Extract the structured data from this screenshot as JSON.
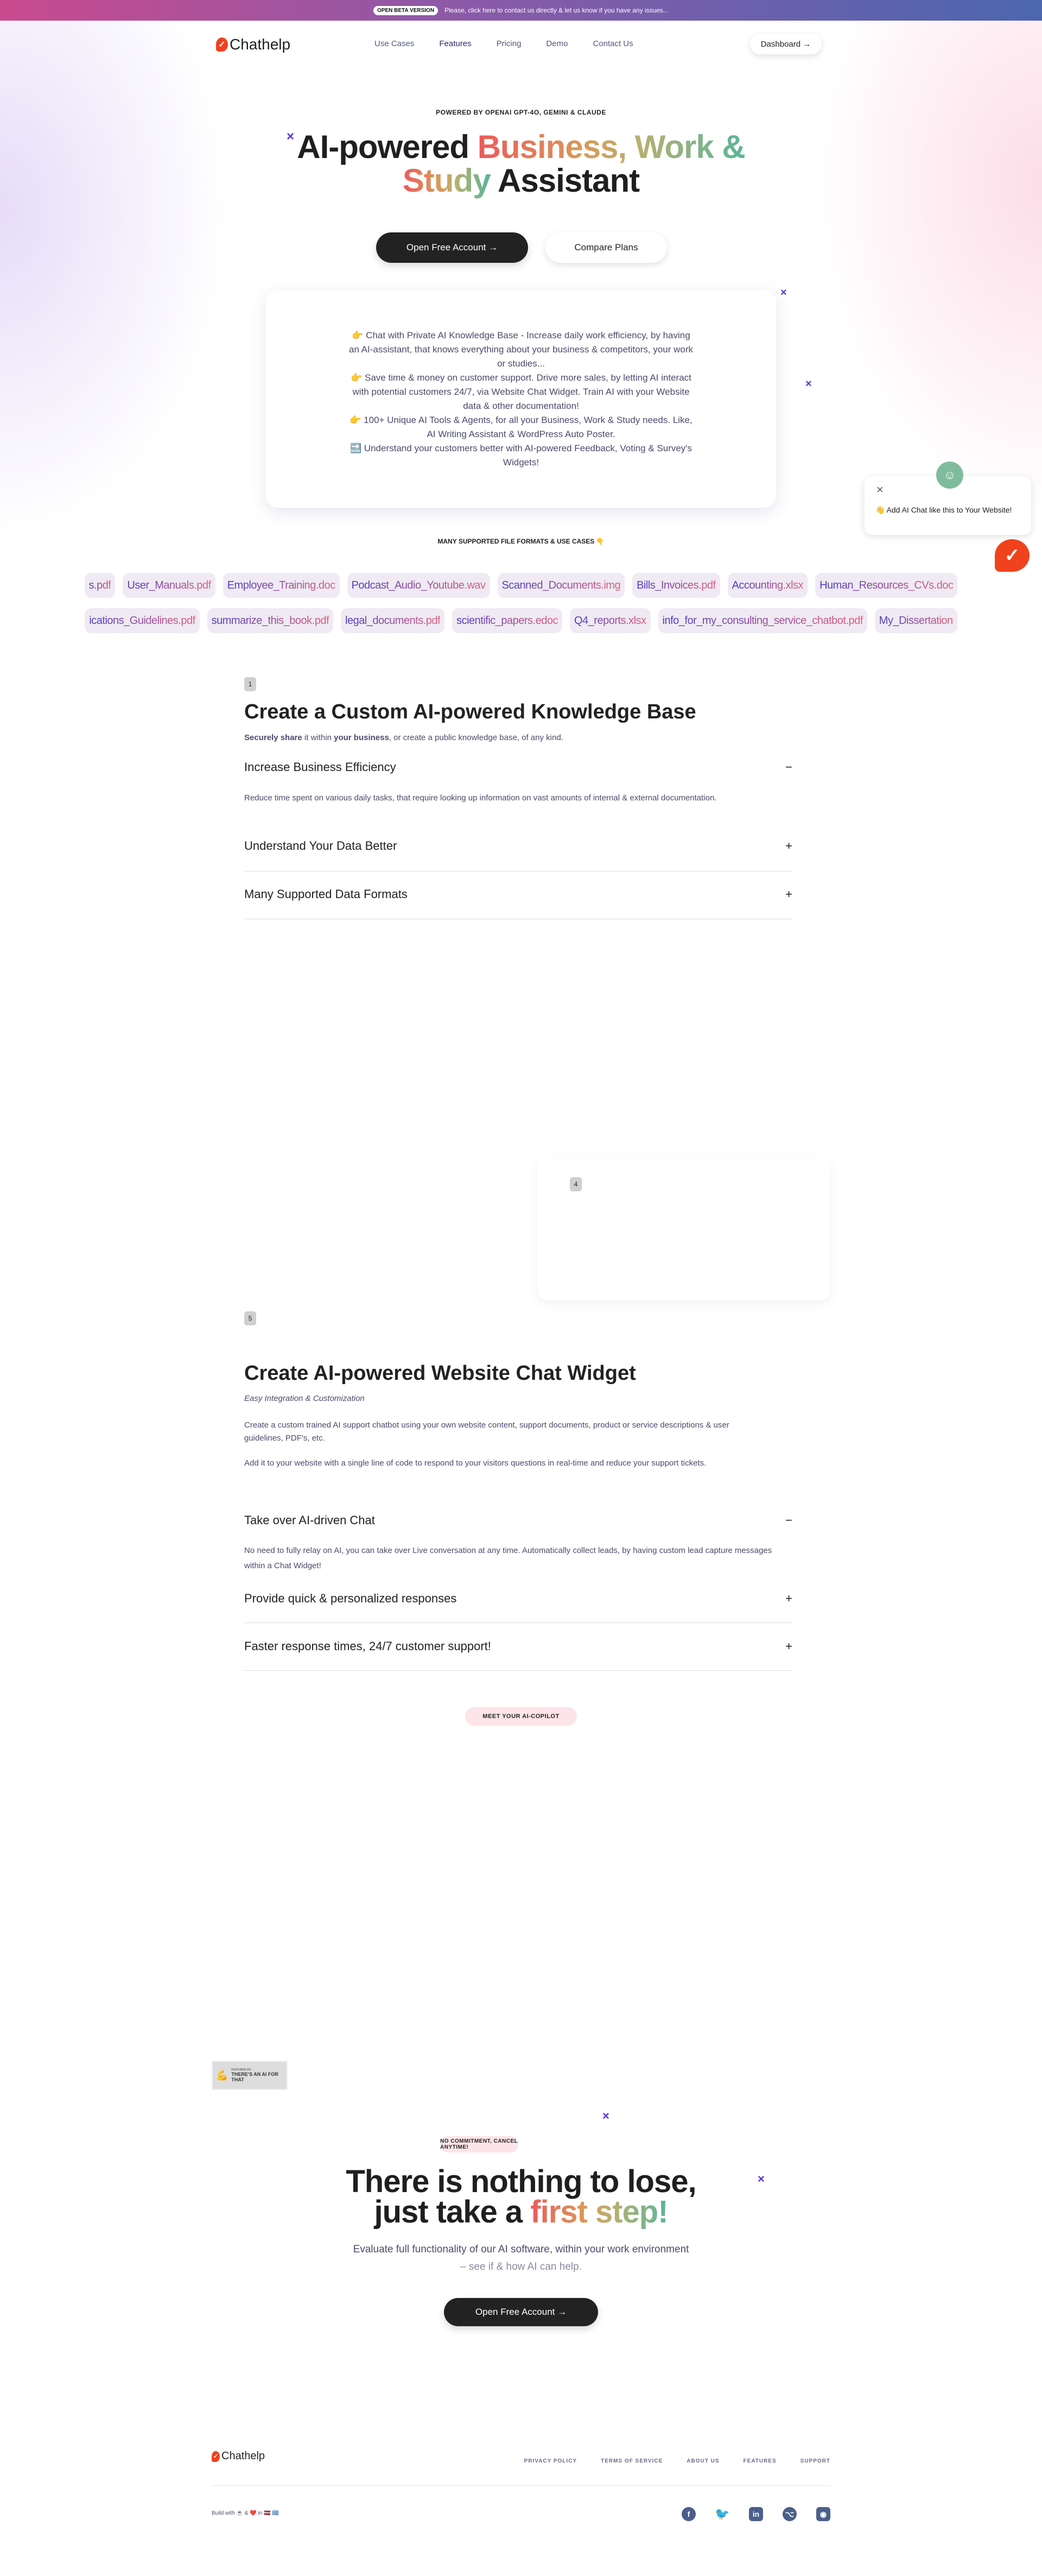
{
  "banner": {
    "badge": "OPEN BETA VERSION",
    "message": "Please, click here to contact us directly & let us know if you have any issues..."
  },
  "nav": {
    "logo": "Chathelp",
    "links": [
      "Use Cases",
      "Features",
      "Pricing",
      "Demo",
      "Contact Us"
    ],
    "active": "Features",
    "dashboard": "Dashboard →"
  },
  "hero": {
    "eyebrow": "POWERED BY OPENAI GPT-4O, GEMINI & CLAUDE",
    "title_plain_1": "AI-powered ",
    "title_grad_1": "Business, Work &",
    "title_grad_2": "Study",
    "title_plain_2": " Assistant",
    "cta_primary": "Open Free Account →",
    "cta_secondary": "Compare Plans",
    "features": [
      "👉 Chat with Private AI Knowledge Base - Increase daily work efficiency, by having an AI-assistant, that knows everything about your business & competitors, your work or studies...",
      "👉 Save time & money on customer support. Drive more sales, by letting AI interact with potential customers 24/7, via Website Chat Widget. Train AI with your Website data & other documentation!",
      "👉 100+ Unique AI Tools & Agents, for all your Business, Work & Study needs. Like, AI Writing Assistant & WordPress Auto Poster.",
      "🔜 Understand your customers better with AI-powered Feedback, Voting & Survey's Widgets!"
    ]
  },
  "chat_popup": {
    "message": "👋 Add AI Chat like this to Your Website!"
  },
  "formats": {
    "title": "MANY SUPPORTED FILE FORMATS & USE CASES 👇",
    "row1": [
      "s.pdf",
      "User_Manuals.pdf",
      "Employee_Training.doc",
      "Podcast_Audio_Youtube.wav",
      "Scanned_Documents.img",
      "Bills_Invoices.pdf",
      "Accounting.xlsx",
      "Human_Resources_CVs.doc"
    ],
    "row2": [
      "ications_Guidelines.pdf",
      "summarize_this_book.pdf",
      "legal_documents.pdf",
      "scientific_papers.edoc",
      "Q4_reports.xlsx",
      "info_for_my_consulting_service_chatbot.pdf",
      "My_Dissertation"
    ]
  },
  "section1": {
    "number": "1",
    "title": "Create a Custom AI-powered Knowledge Base",
    "sub_b1": "Securely share",
    "sub_t1": " it within ",
    "sub_b2": "your business",
    "sub_t2": ", or create a public knowledge base, of any kind.",
    "accordion": [
      {
        "title": "Increase Business Efficiency",
        "icon": "−",
        "body": "Reduce time spent on various daily tasks, that require looking up information on vast amounts of internal & external documentation."
      },
      {
        "title": "Understand Your Data Better",
        "icon": "+"
      },
      {
        "title": "Many Supported Data Formats",
        "icon": "+"
      }
    ]
  },
  "card4": {
    "number": "4"
  },
  "section5": {
    "number": "5",
    "title": "Create AI-powered Website Chat Widget",
    "subtitle": "Easy Integration & Customization",
    "p1": "Create a custom trained AI support chatbot using your own website content, support documents, product or service descriptions & user guidelines, PDF's, etc.",
    "p2": "Add it to your website with a single line of code to respond to your visitors questions in real-time and reduce your support tickets.",
    "accordion": [
      {
        "title": "Take over AI-driven Chat",
        "icon": "−",
        "body": "No need to fully relay on AI, you can take over Live conversation at any time. Automatically collect leads, by having custom lead capture messages within a Chat Widget!"
      },
      {
        "title": "Provide quick & personalized responses",
        "icon": "+"
      },
      {
        "title": "Faster response times, 24/7 customer support!",
        "icon": "+"
      }
    ]
  },
  "copilot_badge": "MEET YOUR AI-COPILOT",
  "featured": {
    "small": "FEATURED ON",
    "big": "THERE'S AN AI FOR THAT"
  },
  "cta": {
    "pill": "NO COMMITMENT, CANCEL ANYTIME!",
    "line1": "There is nothing to lose,",
    "line2_plain": "just take a ",
    "line2_grad": "first step!",
    "text1": "Evaluate full functionality of our AI software, within your work environment",
    "text2": "– see if & how AI can help.",
    "button": "Open Free Account →"
  },
  "footer": {
    "logo": "Chathelp",
    "links": [
      "PRIVACY POLICY",
      "TERMS OF SERVICE",
      "ABOUT US",
      "FEATURES",
      "SUPPORT"
    ],
    "build": "Build with ☕ & ❤️ in 🇱🇻 🇬🇷",
    "socials": [
      "facebook-icon",
      "twitter-icon",
      "linkedin-icon",
      "github-icon",
      "discord-icon"
    ]
  },
  "colors": {
    "brand": "#f0421d",
    "dark": "#222222",
    "accent_purple": "#5b2fe0",
    "pill_pink": "#fde4e8"
  }
}
